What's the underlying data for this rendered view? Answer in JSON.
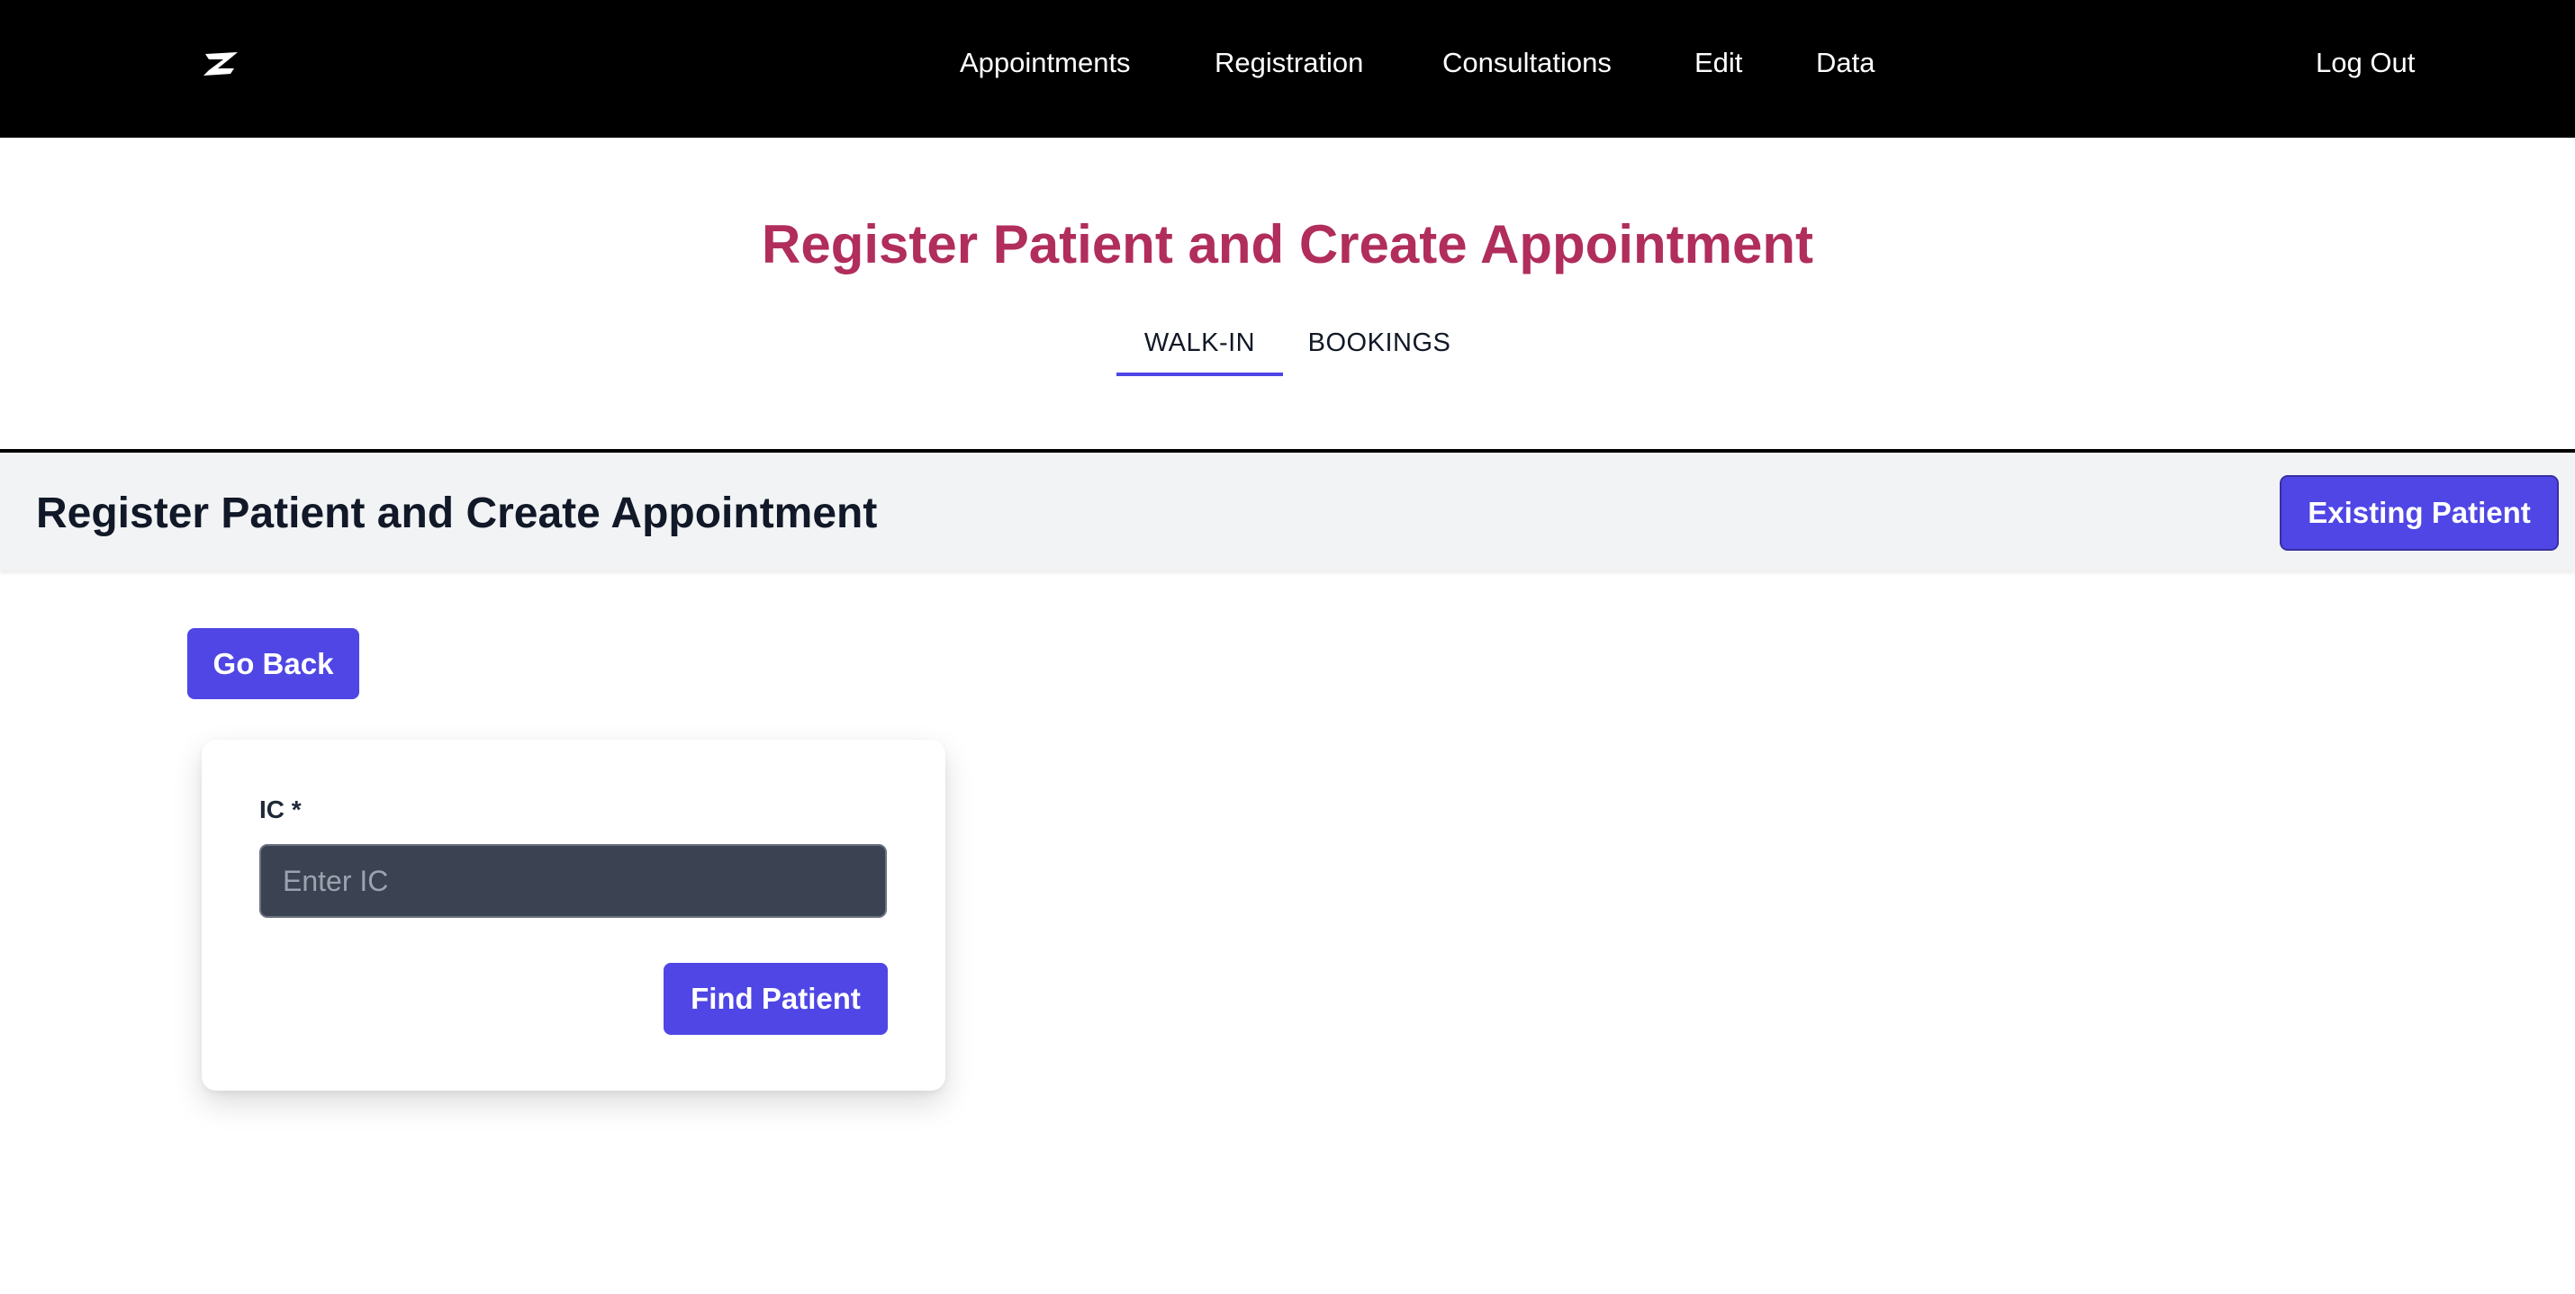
{
  "navbar": {
    "logo_icon": "z-logo-icon",
    "items": [
      {
        "label": "Appointments"
      },
      {
        "label": "Registration"
      },
      {
        "label": "Consultations"
      },
      {
        "label": "Edit"
      },
      {
        "label": "Data"
      }
    ],
    "logout_label": "Log Out"
  },
  "page": {
    "title": "Register Patient and Create Appointment",
    "tabs": [
      {
        "label": "WALK-IN",
        "active": true
      },
      {
        "label": "BOOKINGS",
        "active": false
      }
    ]
  },
  "section": {
    "title": "Register Patient and Create Appointment",
    "existing_patient_label": "Existing Patient"
  },
  "actions": {
    "go_back_label": "Go Back"
  },
  "form": {
    "ic_label": "IC *",
    "ic_value": "",
    "ic_placeholder": "Enter IC",
    "submit_label": "Find Patient"
  },
  "colors": {
    "accent": "#4f46e5",
    "title": "#b02d5c",
    "navbar_bg": "#000000",
    "header_band_bg": "#f2f3f5",
    "input_bg": "#3b4252"
  }
}
